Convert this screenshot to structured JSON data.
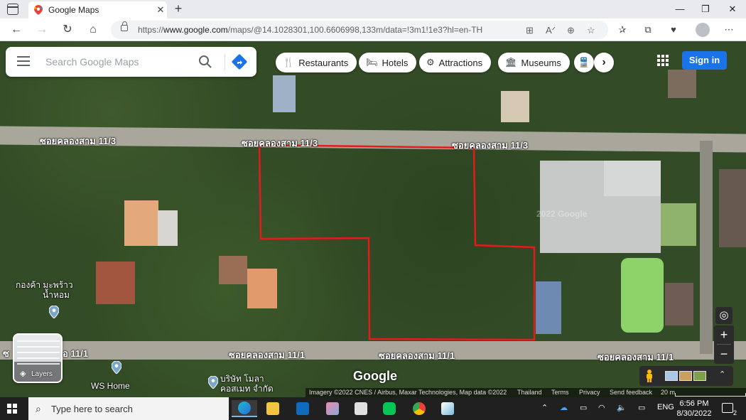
{
  "browser": {
    "tab_title": "Google Maps",
    "tab_close": "✕",
    "new_tab": "+",
    "url_prefix": "https://",
    "url_host": "www.google.com",
    "url_path": "/maps/@14.1028301,100.6606998,133m/data=!3m1!1e3?hl=en-TH",
    "window_controls": [
      "—",
      "❐",
      "✕"
    ]
  },
  "search": {
    "placeholder": "Search Google Maps"
  },
  "chips": [
    {
      "label": "Restaurants",
      "icon": "fork-knife-icon",
      "glyph": "🍴"
    },
    {
      "label": "Hotels",
      "icon": "bed-icon",
      "glyph": "🛏"
    },
    {
      "label": "Attractions",
      "icon": "camera-icon",
      "glyph": "⚙"
    },
    {
      "label": "Museums",
      "icon": "museum-icon",
      "glyph": "🏛"
    }
  ],
  "signin_label": "Sign in",
  "layers_label": "Layers",
  "google_logo": "Google",
  "map_labels": {
    "road_1": "ซอยคลองสาม 11/3",
    "road_2": "ซอยคลองสาม 11/3",
    "road_3": "ซอยคลองสาม 11/3",
    "road_4": "ซ",
    "road_4b": "อ 11/1",
    "road_5": "ซอยคลองสาม 11/1",
    "road_6": "ซอยคลองสาม 11/1",
    "road_7": "ซอยคลองสาม 11/1",
    "watermark": "2022 Google"
  },
  "pois": {
    "poi_1_line1": "กองค้า มะพร้าว",
    "poi_1_line2": "น้ำหอม",
    "poi_2": "WS Home",
    "poi_3_line1": "บริษัท โมลา",
    "poi_3_line2": "คอสเมท จำกัด"
  },
  "footer": {
    "imagery": "Imagery ©2022 CNES / Airbus, Maxar Technologies, Map data ©2022",
    "country": "Thailand",
    "terms": "Terms",
    "privacy": "Privacy",
    "feedback": "Send feedback",
    "scale": "20 m"
  },
  "taskbar": {
    "search_placeholder": "Type here to search",
    "language": "ENG",
    "time": "6:56 PM",
    "date": "8/30/2022",
    "notification_count": "2"
  },
  "colors": {
    "parcel_outline": "#e31b1b",
    "signin_bg": "#1a73e8",
    "directions": "#1a73e8"
  }
}
